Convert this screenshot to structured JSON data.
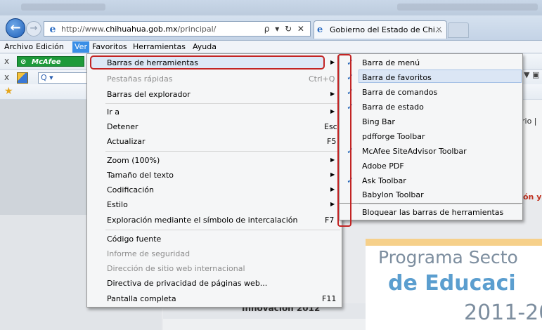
{
  "browser": {
    "url_prefix": "http://www.",
    "url_domain": "chihuahua.gob.mx",
    "url_path": "/principal/",
    "url_controls": "ρ ▾ ↻ ✕",
    "tab_label": "Gobierno del Estado de Chi...",
    "tab_close": "×"
  },
  "menubar": {
    "items": [
      "Archivo",
      "Edición",
      "Ver",
      "Favoritos",
      "Herramientas",
      "Ayuda"
    ],
    "active": "Ver"
  },
  "toolbars": {
    "close_glyph": "x",
    "mcafee_label": "McAfee",
    "search_label": "Q ▾"
  },
  "view_menu": {
    "items": [
      {
        "label": "Barras de herramientas",
        "shortcut": "",
        "submenu": true,
        "disabled": false
      },
      {
        "label": "Pestañas rápidas",
        "shortcut": "Ctrl+Q",
        "submenu": false,
        "disabled": true
      },
      {
        "label": "Barras del explorador",
        "shortcut": "",
        "submenu": true,
        "disabled": false
      },
      {
        "label": "Ir a",
        "shortcut": "",
        "submenu": true,
        "disabled": false
      },
      {
        "label": "Detener",
        "shortcut": "Esc",
        "submenu": false,
        "disabled": false
      },
      {
        "label": "Actualizar",
        "shortcut": "F5",
        "submenu": false,
        "disabled": false
      },
      {
        "label": "Zoom (100%)",
        "shortcut": "",
        "submenu": true,
        "disabled": false
      },
      {
        "label": "Tamaño del texto",
        "shortcut": "",
        "submenu": true,
        "disabled": false
      },
      {
        "label": "Codificación",
        "shortcut": "",
        "submenu": true,
        "disabled": false
      },
      {
        "label": "Estilo",
        "shortcut": "",
        "submenu": true,
        "disabled": false
      },
      {
        "label": "Exploración mediante el símbolo de intercalación",
        "shortcut": "F7",
        "submenu": false,
        "disabled": false
      },
      {
        "label": "Código fuente",
        "shortcut": "",
        "submenu": false,
        "disabled": false
      },
      {
        "label": "Informe de seguridad",
        "shortcut": "",
        "submenu": false,
        "disabled": true
      },
      {
        "label": "Dirección de sitio web internacional",
        "shortcut": "",
        "submenu": false,
        "disabled": true
      },
      {
        "label": "Directiva de privacidad de páginas web...",
        "shortcut": "",
        "submenu": false,
        "disabled": false
      },
      {
        "label": "Pantalla completa",
        "shortcut": "F11",
        "submenu": false,
        "disabled": false
      }
    ]
  },
  "toolbars_submenu": {
    "items": [
      {
        "label": "Barra de menú",
        "checked": true
      },
      {
        "label": "Barra de favoritos",
        "checked": true
      },
      {
        "label": "Barra de comandos",
        "checked": true
      },
      {
        "label": "Barra de estado",
        "checked": true
      },
      {
        "label": "Bing Bar",
        "checked": false
      },
      {
        "label": "pdfforge Toolbar",
        "checked": false
      },
      {
        "label": "McAfee SiteAdvisor Toolbar",
        "checked": true
      },
      {
        "label": "Adobe PDF",
        "checked": false
      },
      {
        "label": "Ask Toolbar",
        "checked": true
      },
      {
        "label": "Babylon Toolbar",
        "checked": false
      }
    ],
    "lock_label": "Bloquear las barras de herramientas",
    "check_glyph": "✓"
  },
  "page": {
    "side_link": "rio |",
    "side_red": "ón y",
    "innovation": "Innovación 2012",
    "program_line1": "Programa Secto",
    "program_line2": "de Educaci",
    "program_line3": "2011-20"
  },
  "colors": {
    "menu_highlight_border": "#c22424",
    "check": "#1c5fb4",
    "active_menu": "#3a8ee6"
  }
}
